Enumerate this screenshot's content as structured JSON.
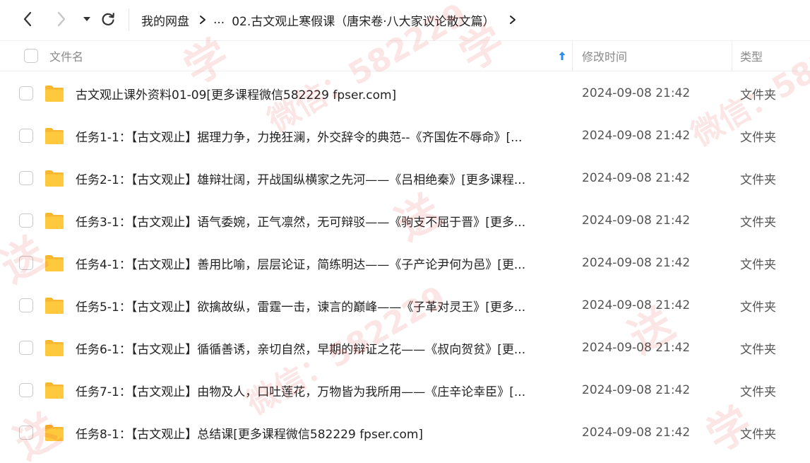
{
  "breadcrumb": {
    "root": "我的网盘",
    "ellipsis": "...",
    "current": "02.古文观止寒假课（唐宋卷·八大家议论散文篇）"
  },
  "table": {
    "columns": {
      "name": "文件名",
      "modified": "修改时间",
      "type": "类型"
    },
    "rows": [
      {
        "name": "古文观止课外资料01-09[更多课程微信582229 fpser.com]",
        "modified": "2024-09-08 21:42",
        "type": "文件夹"
      },
      {
        "name": "任务1-1：【古文观止】据理力争，力挽狂澜，外交辞令的典范--《齐国佐不辱命》[...",
        "modified": "2024-09-08 21:42",
        "type": "文件夹"
      },
      {
        "name": "任务2-1：【古文观止】雄辩壮阔，开战国纵横家之先河——《吕相绝秦》[更多课程...",
        "modified": "2024-09-08 21:42",
        "type": "文件夹"
      },
      {
        "name": "任务3-1：【古文观止】语气委婉，正气凛然，无可辩驳——《驹支不屈于晋》[更多...",
        "modified": "2024-09-08 21:42",
        "type": "文件夹"
      },
      {
        "name": "任务4-1：【古文观止】善用比喻，层层论证，简练明达——《子产论尹何为邑》[更...",
        "modified": "2024-09-08 21:42",
        "type": "文件夹"
      },
      {
        "name": "任务5-1：【古文观止】欲擒故纵，雷霆一击，谏言的巅峰——《子革对灵王》[更多...",
        "modified": "2024-09-08 21:42",
        "type": "文件夹"
      },
      {
        "name": "任务6-1：【古文观止】循循善诱，亲切自然，早期的辩证之花——《叔向贺贫》[更...",
        "modified": "2024-09-08 21:42",
        "type": "文件夹"
      },
      {
        "name": "任务7-1：【古文观止】由物及人，口吐莲花，万物皆为我所用——《庄辛论幸臣》[...",
        "modified": "2024-09-08 21:42",
        "type": "文件夹"
      },
      {
        "name": "任务8-1：【古文观止】总结课[更多课程微信582229 fpser.com]",
        "modified": "2024-09-08 21:42",
        "type": "文件夹"
      }
    ]
  },
  "watermark": {
    "text_a": "学",
    "text_b": "微信：582229",
    "text_c": "送"
  },
  "icons": {
    "back": "chevron-left-icon",
    "forward": "chevron-right-icon",
    "dropdown": "caret-down-icon",
    "refresh": "refresh-icon",
    "sort": "sort-ascending-arrow-icon",
    "folder": "folder-icon"
  },
  "colors": {
    "folder": "#FFC93D",
    "sort_arrow": "#2D8CF0",
    "watermark": "#DC2828"
  }
}
